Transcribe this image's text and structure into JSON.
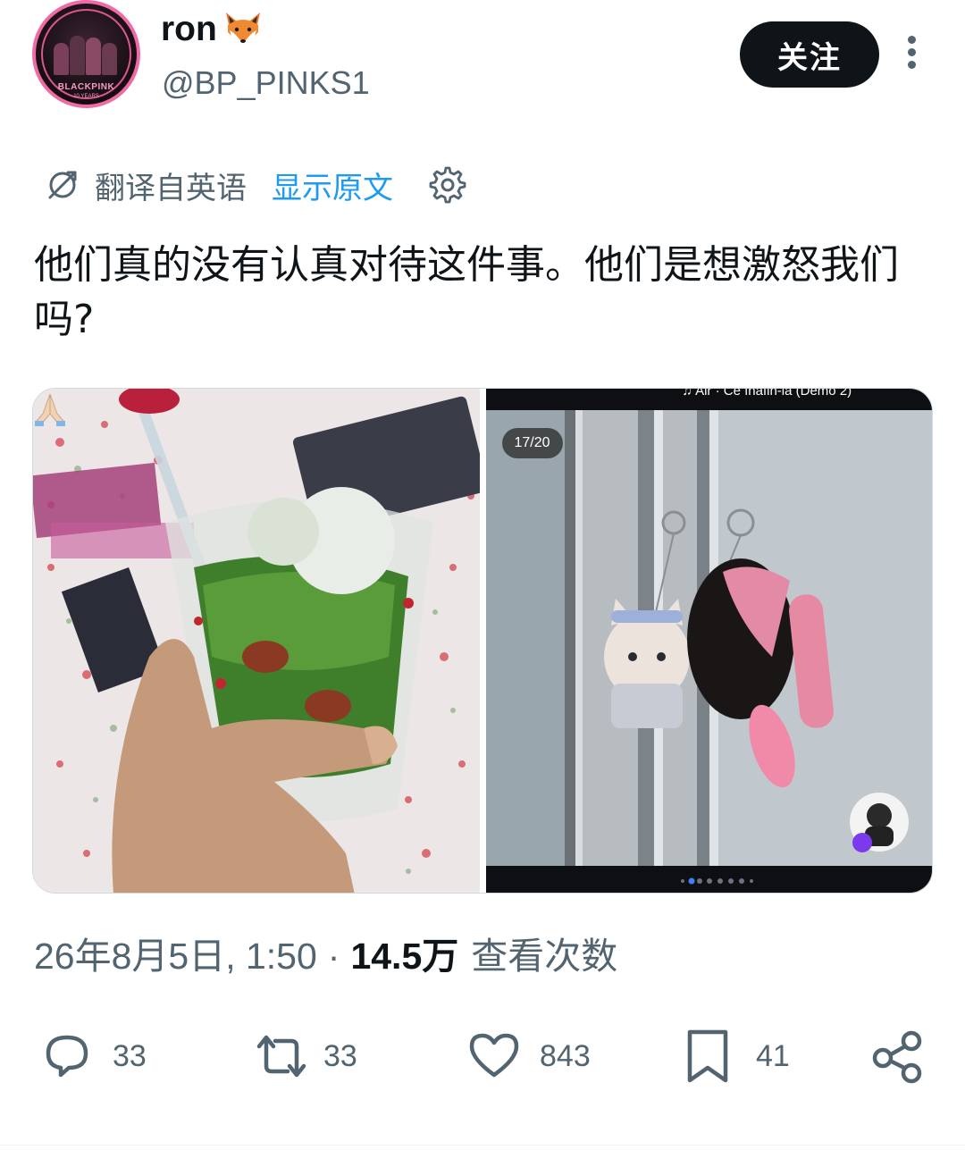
{
  "author": {
    "display_name": "ron",
    "handle": "@BP_PINKS1",
    "avatar_brand": "BLACKPINK",
    "avatar_sub": "10 YEARS"
  },
  "follow_label": "关注",
  "translation": {
    "label": "翻译自英语",
    "show_original": "显示原文"
  },
  "tweet": {
    "text": "他们真的没有认真对待这件事。他们是想激怒我们吗?"
  },
  "media": {
    "photo2_counter": "17/20",
    "photo2_music": "♫ Air · Ce înafin-la (Demo 2)"
  },
  "meta": {
    "timestamp": "26年8月5日, 1:50",
    "separator": "·",
    "views": "14.5万",
    "views_label": "查看次数"
  },
  "actions": {
    "replies": "33",
    "reposts": "33",
    "likes": "843",
    "bookmarks": "41"
  },
  "colors": {
    "primary_text": "#0f1419",
    "secondary_text": "#536471",
    "link": "#1d9bf0",
    "follow_bg": "#0f1419"
  },
  "icons": [
    "fox-emoji",
    "more-dots-icon",
    "translate-icon",
    "gear-icon",
    "reply-icon",
    "repost-icon",
    "like-icon",
    "bookmark-icon",
    "share-icon",
    "pray-emoji"
  ]
}
